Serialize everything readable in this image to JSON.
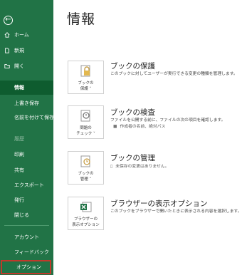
{
  "sidebar": {
    "back": "←",
    "items": [
      {
        "label": "ホーム"
      },
      {
        "label": "新規"
      },
      {
        "label": "開く"
      },
      {
        "label": "情報"
      },
      {
        "label": "上書き保存"
      },
      {
        "label": "名前を付けて保存"
      },
      {
        "label": "履歴"
      },
      {
        "label": "印刷"
      },
      {
        "label": "共有"
      },
      {
        "label": "エクスポート"
      },
      {
        "label": "発行"
      },
      {
        "label": "閉じる"
      },
      {
        "label": "アカウント"
      },
      {
        "label": "フィードバック"
      },
      {
        "label": "オプション"
      }
    ]
  },
  "page": {
    "title": "情報"
  },
  "sections": [
    {
      "tile": "ブックの\n保護 ˅",
      "title": "ブックの保護",
      "desc": "このブックに対してユーザーが実行できる変更の種類を管理します。"
    },
    {
      "tile": "問題の\nチェック ˅",
      "title": "ブックの検査",
      "desc": "ファイルを公開する前に、ファイルの次の項目を確認します。",
      "sub": "作成者の名前、絶対パス"
    },
    {
      "tile": "ブックの\n管理 ˅",
      "title": "ブックの管理",
      "sub": "未保存の変更はありません。"
    },
    {
      "tile": "ブラウザーの\n表示オプション",
      "title": "ブラウザーの表示オプション",
      "desc": "このブックをブラウザーで開いたときに表示される内容を選択します。"
    }
  ],
  "colors": {
    "sidebar": "#217346",
    "selected": "#0e5c2f",
    "highlight": "#c0392b"
  }
}
